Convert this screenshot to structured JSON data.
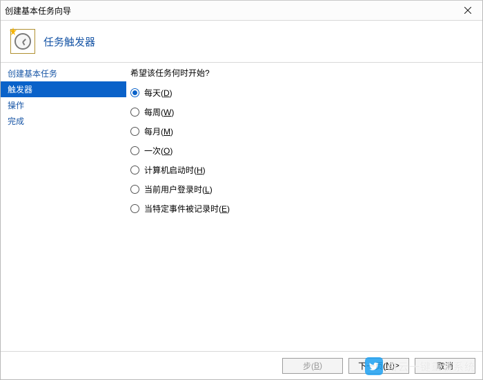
{
  "window": {
    "title": "创建基本任务向导"
  },
  "header": {
    "title": "任务触发器"
  },
  "sidebar": {
    "items": [
      {
        "label": "创建基本任务",
        "active": false
      },
      {
        "label": "触发器",
        "active": true
      },
      {
        "label": "操作",
        "active": false
      },
      {
        "label": "完成",
        "active": false
      }
    ]
  },
  "content": {
    "prompt": "希望该任务何时开始?",
    "options": [
      {
        "text": "每天",
        "hotkey": "D",
        "selected": true
      },
      {
        "text": "每周",
        "hotkey": "W",
        "selected": false
      },
      {
        "text": "每月",
        "hotkey": "M",
        "selected": false
      },
      {
        "text": "一次",
        "hotkey": "O",
        "selected": false
      },
      {
        "text": "计算机启动时",
        "hotkey": "H",
        "selected": false
      },
      {
        "text": "当前用户登录时",
        "hotkey": "L",
        "selected": false
      },
      {
        "text": "当特定事件被记录时",
        "hotkey": "E",
        "selected": false
      }
    ]
  },
  "footer": {
    "back": {
      "text": "步",
      "hotkey": "B",
      "enabled": false
    },
    "next": {
      "text": "下一页",
      "hotkey": "N",
      "suffix": ">",
      "enabled": true
    },
    "cancel": {
      "text": "取消",
      "enabled": true
    }
  },
  "watermark": {
    "text": "白云一键重装系统",
    "url": "www.baiyunxitong.com"
  }
}
